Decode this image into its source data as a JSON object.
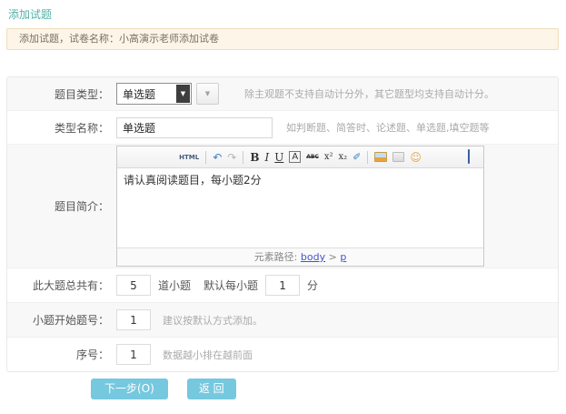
{
  "page_title": "添加试题",
  "notice_text": "添加试题，试卷名称：小高演示老师添加试卷",
  "form": {
    "question_type": {
      "label": "题目类型：",
      "selected": "单选题",
      "arrow": "▼",
      "hint": "除主观题不支持自动计分外，其它题型均支持自动计分。"
    },
    "type_name": {
      "label": "类型名称：",
      "value": "单选题",
      "hint": "如判断题、简答时、论述题、单选题,填空题等"
    },
    "intro": {
      "label": "题目简介：",
      "content": "请认真阅读题目，每小题2分",
      "path_prefix": "元素路径: ",
      "path_body": "body",
      "path_sep": " > ",
      "path_p": "p"
    },
    "sub_questions": {
      "label": "此大题总共有：",
      "count": "5",
      "count_unit": "道小题",
      "score_label": "默认每小题",
      "score": "1",
      "score_unit": "分"
    },
    "start_no": {
      "label": "小题开始题号：",
      "value": "1",
      "hint": "建议按默认方式添加。"
    },
    "order": {
      "label": "序号：",
      "value": "1",
      "hint": "数据越小排在越前面"
    }
  },
  "editor_toolbar": {
    "html": "HTML",
    "undo": "↶",
    "redo": "↷",
    "bold": "B",
    "italic": "I",
    "underline": "U",
    "forecolor": "A",
    "strikethrough": "ABC",
    "superscript": "x²",
    "subscript": "x₂",
    "eraser": "✐",
    "smiley": "☺"
  },
  "buttons": {
    "next": "下一步(O)",
    "back": "返 回"
  },
  "colors": {
    "accent_teal": "#53b2a7",
    "notice_bg": "#fcf5e8",
    "notice_border": "#f0ddba",
    "button_blue": "#76c8df",
    "link_blue": "#4455cc",
    "row_stripe": "#f8f8f8"
  }
}
